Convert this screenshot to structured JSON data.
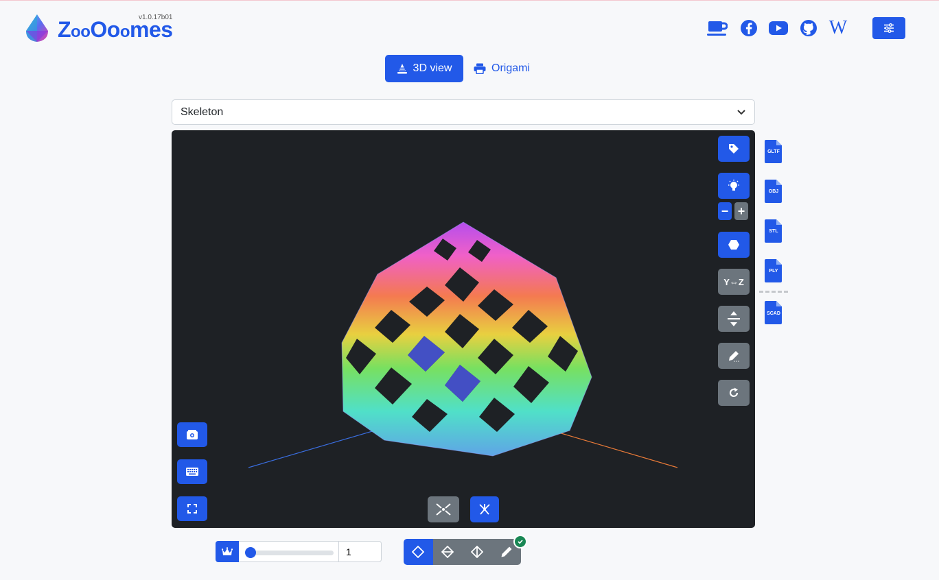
{
  "header": {
    "brand_big1": "Z",
    "brand_small1": "oo",
    "brand_big2": "Oo",
    "brand_small2": "o",
    "brand_rest": "mes",
    "version": "v1.0.17b01",
    "icons": [
      "coffee-icon",
      "facebook-icon",
      "youtube-icon",
      "github-icon",
      "wikipedia-icon"
    ],
    "wikipedia_glyph": "W"
  },
  "tabs": {
    "view3d": "3D view",
    "origami": "Origami"
  },
  "model_select": {
    "value": "Skeleton"
  },
  "viewport": {
    "swap_axes_label": "Y⇔Z",
    "zoom_out": "−",
    "zoom_in": "+"
  },
  "exports": [
    {
      "label": "GLTF"
    },
    {
      "label": "OBJ"
    },
    {
      "label": "STL"
    },
    {
      "label": "PLY"
    },
    {
      "label": "SCAD"
    }
  ],
  "bottom": {
    "count_value": "1",
    "slider_fraction": 0.0
  },
  "colors": {
    "primary": "#2259e8",
    "secondary": "#6c757d",
    "viewport_bg": "#1e2125",
    "success": "#198754"
  }
}
